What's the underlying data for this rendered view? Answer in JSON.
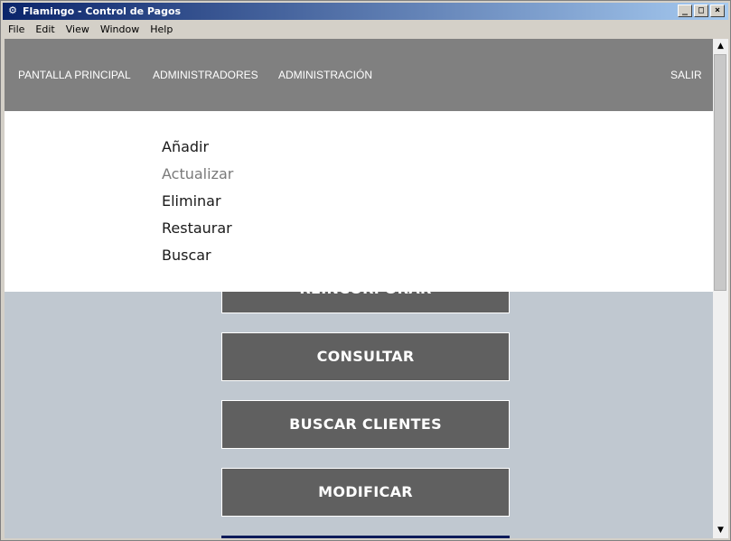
{
  "window": {
    "title": "Flamingo - Control de Pagos",
    "icon": "gear-icon",
    "buttons": {
      "minimize": "_",
      "maximize": "□",
      "close": "×"
    }
  },
  "menubar": {
    "items": [
      "File",
      "Edit",
      "View",
      "Window",
      "Help"
    ]
  },
  "nav": {
    "pantalla_principal": "PANTALLA PRINCIPAL",
    "administradores": "ADMINISTRADORES",
    "administracion": "ADMINISTRACIÓN",
    "salir": "SALIR"
  },
  "dropdown": {
    "items": [
      "Añadir",
      "Actualizar",
      "Eliminar",
      "Restaurar",
      "Buscar"
    ],
    "hovered_index": 1
  },
  "actions": {
    "reincorporar": "REINCORPORAR",
    "consultar": "CONSULTAR",
    "buscar_clientes": "BUSCAR CLIENTES",
    "modificar": "MODIFICAR"
  },
  "colors": {
    "nav_bg": "#808080",
    "content_bg": "#c0c8d0",
    "button_bg": "#606060",
    "accent_bar": "#0a1a5a"
  }
}
